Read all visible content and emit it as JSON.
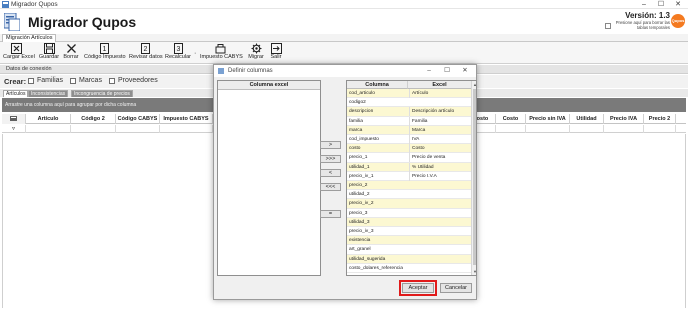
{
  "window": {
    "title": "Migrador Qupos",
    "controls": [
      "–",
      "☐",
      "✕"
    ]
  },
  "header": {
    "app_title": "Migrador Qupos",
    "version": "Versión: 1.3",
    "note": "Presione aquí para borrar las tablas temporales",
    "logo_text": "Qupos",
    "logo_color": "#f47a20"
  },
  "main_tab": "Migración Artículos",
  "toolbar": [
    {
      "label": "Cargar Excel",
      "icon": "excel-icon"
    },
    {
      "label": "Guardar",
      "icon": "save-icon"
    },
    {
      "label": "Borrar",
      "icon": "delete-icon"
    },
    {
      "label": "Código Impuesto",
      "icon": "tax-code-icon"
    },
    {
      "label": "Revisar datos",
      "icon": "review-icon"
    },
    {
      "label": "Recalcular",
      "icon": "recalculate-icon"
    },
    {
      "label": "Impuesto CABYS",
      "icon": "cabys-icon"
    },
    {
      "label": "Migrar",
      "icon": "gear-icon"
    },
    {
      "label": "Salir",
      "icon": "exit-icon"
    }
  ],
  "connection_label": "Datos de conexión",
  "crear": {
    "label": "Crear:",
    "options": [
      "Familias",
      "Marcas",
      "Proveedores"
    ]
  },
  "sub_tabs": [
    "Artículos",
    "Inconsistencias",
    "Incongruencia de precios"
  ],
  "group_hint": "Arrastre una columna aquí para agrupar por dicha columna",
  "grid_columns": [
    "Artículo",
    "Código 2",
    "Código CABYS",
    "Impuesto CABYS",
    "Costo",
    "Costo",
    "Precio sin IVA",
    "Utilidad",
    "Precio IVA",
    "Precio 2"
  ],
  "dialog": {
    "title": "Definir columnas",
    "left_header": "Columna excel",
    "table_headers": [
      "Columna",
      "Excel"
    ],
    "move_buttons": [
      ">",
      ">>>",
      "<",
      "<<<",
      "="
    ],
    "rows": [
      {
        "columna": "cod_articulo",
        "excel": "Artículo"
      },
      {
        "columna": "codigo2",
        "excel": ""
      },
      {
        "columna": "descripcion",
        "excel": "Descripción artículo"
      },
      {
        "columna": "familia",
        "excel": "Familia"
      },
      {
        "columna": "marca",
        "excel": "Marca"
      },
      {
        "columna": "cod_impuesto",
        "excel": "IVA"
      },
      {
        "columna": "costo",
        "excel": "Costo"
      },
      {
        "columna": "precio_1",
        "excel": "Precio de venta"
      },
      {
        "columna": "utilidad_1",
        "excel": "% Utilidad"
      },
      {
        "columna": "precio_iv_1",
        "excel": "Precio I.V.A"
      },
      {
        "columna": "precio_2",
        "excel": ""
      },
      {
        "columna": "utilidad_2",
        "excel": ""
      },
      {
        "columna": "precio_iv_2",
        "excel": ""
      },
      {
        "columna": "precio_3",
        "excel": ""
      },
      {
        "columna": "utilidad_3",
        "excel": ""
      },
      {
        "columna": "precio_iv_3",
        "excel": ""
      },
      {
        "columna": "existencia",
        "excel": ""
      },
      {
        "columna": "art_granel",
        "excel": ""
      },
      {
        "columna": "utilidad_sugerida",
        "excel": ""
      },
      {
        "columna": "costo_dolares_referencia",
        "excel": ""
      }
    ],
    "accept_label": "Aceptar",
    "cancel_label": "Cancelar",
    "highlight_color": "#e11b1b"
  }
}
